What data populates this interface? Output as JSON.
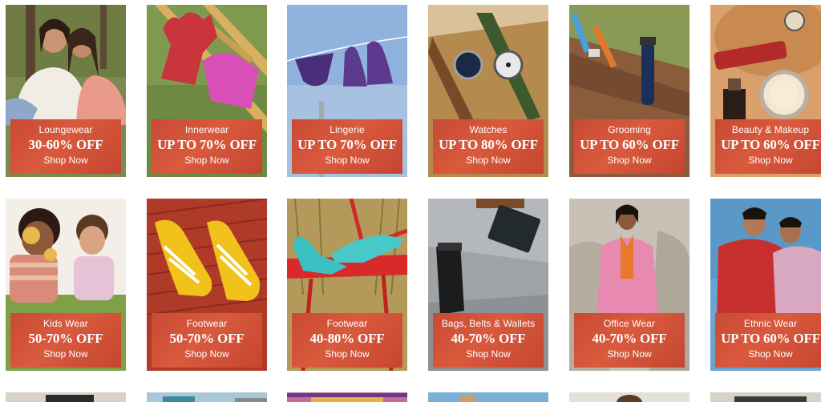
{
  "tiles": [
    {
      "category": "Loungewear",
      "offer": "30-60% OFF",
      "cta": "Shop Now",
      "image": "two-women-loungewear"
    },
    {
      "category": "Innerwear",
      "offer": "UP TO 70% OFF",
      "cta": "Shop Now",
      "image": "vests-on-ladder"
    },
    {
      "category": "Lingerie",
      "offer": "UP TO 70% OFF",
      "cta": "Shop Now",
      "image": "lingerie-on-clothesline"
    },
    {
      "category": "Watches",
      "offer": "UP TO 80% OFF",
      "cta": "Shop Now",
      "image": "wrist-watches-on-basket"
    },
    {
      "category": "Grooming",
      "offer": "UP TO 60% OFF",
      "cta": "Shop Now",
      "image": "razors-and-trimmer"
    },
    {
      "category": "Beauty & Makeup",
      "offer": "UP TO 60% OFF",
      "cta": "Shop Now",
      "image": "makeup-products"
    },
    {
      "category": "Kids Wear",
      "offer": "50-70% OFF",
      "cta": "Shop Now",
      "image": "two-kids-playing"
    },
    {
      "category": "Footwear",
      "offer": "50-70% OFF",
      "cta": "Shop Now",
      "image": "yellow-sneakers"
    },
    {
      "category": "Footwear",
      "offer": "40-80% OFF",
      "cta": "Shop Now",
      "image": "teal-heels-on-chair"
    },
    {
      "category": "Bags, Belts & Wallets",
      "offer": "40-70% OFF",
      "cta": "Shop Now",
      "image": "belt-and-wallet"
    },
    {
      "category": "Office Wear",
      "offer": "40-70% OFF",
      "cta": "Shop Now",
      "image": "woman-pink-suit"
    },
    {
      "category": "Ethnic Wear",
      "offer": "UP TO 60% OFF",
      "cta": "Shop Now",
      "image": "two-men-kurtas"
    }
  ],
  "colors": {
    "badge": "#cf4f36",
    "badge_text": "#ffffff"
  }
}
